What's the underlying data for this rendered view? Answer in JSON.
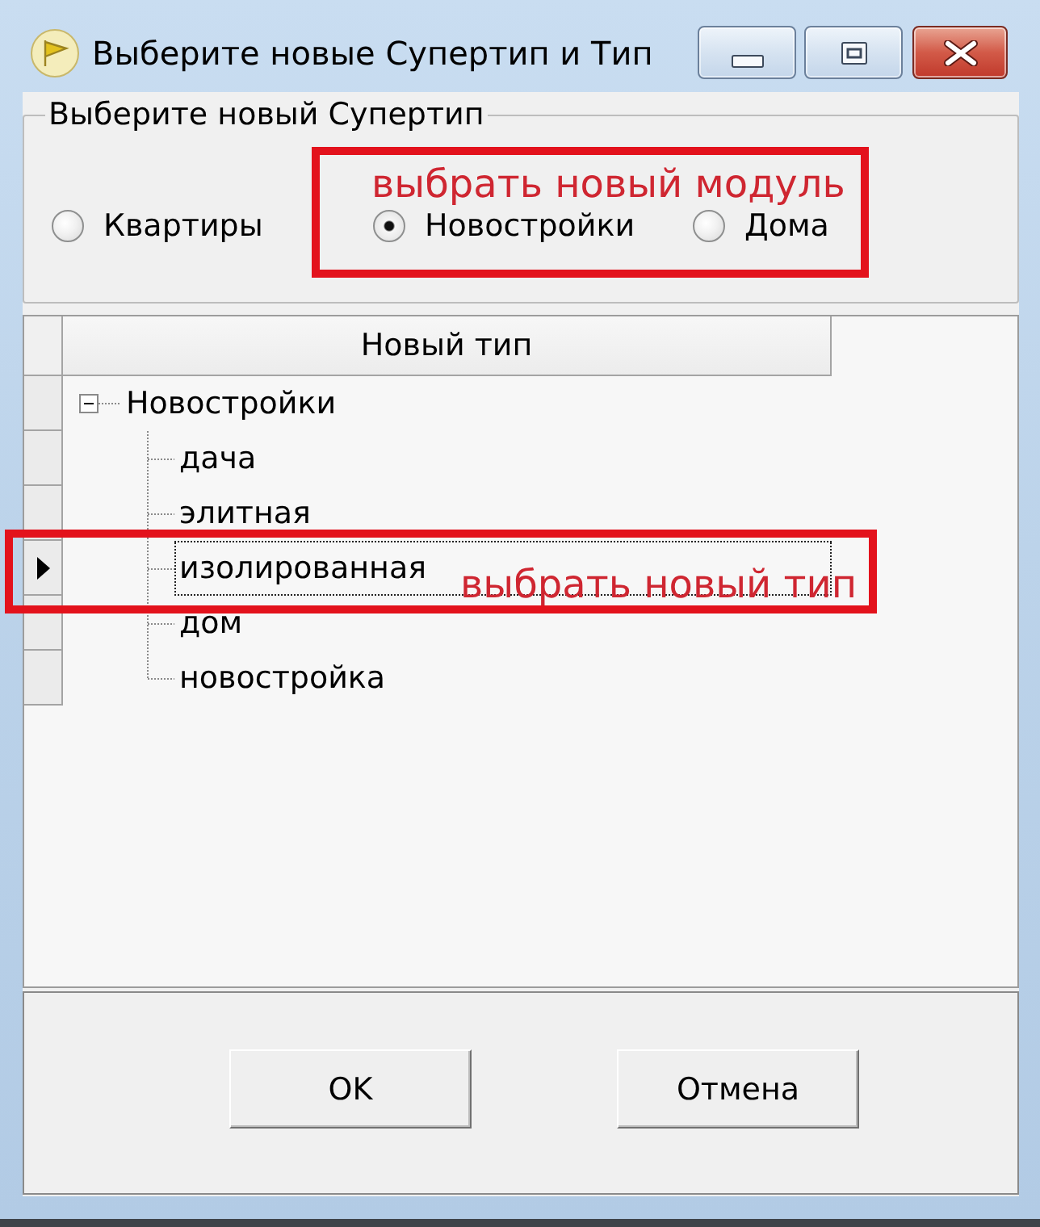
{
  "window": {
    "title": "Выберите новые Супертип и Тип"
  },
  "supertype_group": {
    "label": "Выберите новый Супертип",
    "options": [
      {
        "label": "Квартиры",
        "selected": false
      },
      {
        "label": "Новостройки",
        "selected": true
      },
      {
        "label": "Дома",
        "selected": false
      }
    ],
    "annotation": "выбрать новый модуль"
  },
  "type_grid": {
    "columns": [
      "Новый тип"
    ],
    "tree": [
      {
        "label": "Новостройки",
        "expanded": true,
        "selected": false,
        "children": [
          {
            "label": "дача",
            "selected": false
          },
          {
            "label": "элитная",
            "selected": false
          },
          {
            "label": "изолированная",
            "selected": true
          },
          {
            "label": "дом",
            "selected": false
          },
          {
            "label": "новостройка",
            "selected": false
          }
        ]
      }
    ],
    "annotation": "выбрать новый тип"
  },
  "buttons": [
    {
      "label": "OK"
    },
    {
      "label": "Отмена"
    }
  ]
}
